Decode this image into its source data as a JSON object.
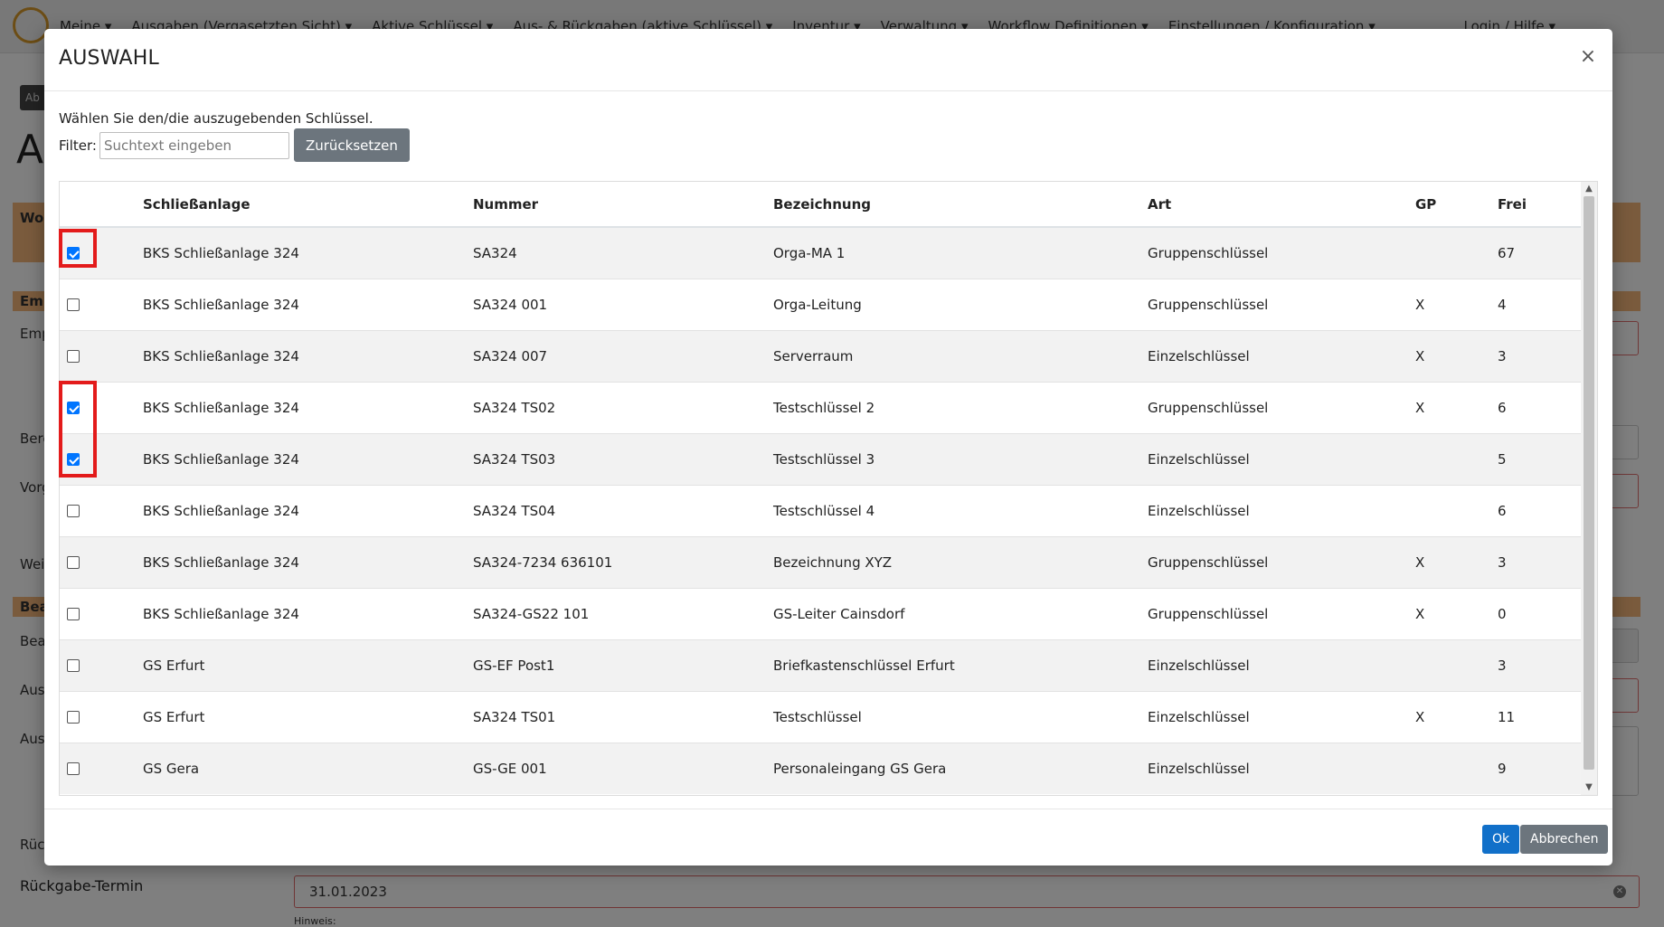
{
  "background": {
    "nav_items": [
      "Meine ▾",
      "Ausgaben (Vergasetzten Sicht) ▾",
      "Aktive Schlüssel ▾",
      "Aus- & Rückgaben (aktive Schlüssel) ▾",
      "Inventur ▾",
      "Verwaltung ▾",
      "Workflow Definitionen ▾",
      "Einstellungen / Konfiguration ▾"
    ],
    "nav_right": "Login / Hilfe ▾",
    "button_label": "Ab",
    "big_title": "Au",
    "band1_label": "Wo",
    "band2_label": "Emp",
    "band3_label": "Bea",
    "labels": [
      "Emp",
      "Bere",
      "Vorg",
      "Wei",
      "Bea",
      "Aus",
      "Aus",
      "Rüc"
    ],
    "return_label": "Rückgabe-Termin",
    "return_value": "31.01.2023",
    "hint": "Hinweis:"
  },
  "modal": {
    "title": "AUSWAHL",
    "close_symbol": "×",
    "intro": "Wählen Sie den/die auszugebenden Schlüssel.",
    "filter_label": "Filter:",
    "filter_placeholder": "Suchtext eingeben",
    "filter_value": "",
    "reset_label": "Zurücksetzen",
    "ok_label": "Ok",
    "cancel_label": "Abbrechen"
  },
  "table": {
    "columns": [
      "",
      "Schließanlage",
      "Nummer",
      "Bezeichnung",
      "Art",
      "GP",
      "Frei"
    ],
    "rows": [
      {
        "checked": true,
        "anlage": "BKS Schließanlage 324",
        "nummer": "SA324",
        "bezeichnung": "Orga-MA 1",
        "art": "Gruppenschlüssel",
        "gp": "",
        "frei": "67"
      },
      {
        "checked": false,
        "anlage": "BKS Schließanlage 324",
        "nummer": "SA324 001",
        "bezeichnung": "Orga-Leitung",
        "art": "Gruppenschlüssel",
        "gp": "X",
        "frei": "4"
      },
      {
        "checked": false,
        "anlage": "BKS Schließanlage 324",
        "nummer": "SA324 007",
        "bezeichnung": "Serverraum",
        "art": "Einzelschlüssel",
        "gp": "X",
        "frei": "3"
      },
      {
        "checked": true,
        "anlage": "BKS Schließanlage 324",
        "nummer": "SA324 TS02",
        "bezeichnung": "Testschlüssel 2",
        "art": "Gruppenschlüssel",
        "gp": "X",
        "frei": "6"
      },
      {
        "checked": true,
        "anlage": "BKS Schließanlage 324",
        "nummer": "SA324 TS03",
        "bezeichnung": "Testschlüssel 3",
        "art": "Einzelschlüssel",
        "gp": "",
        "frei": "5"
      },
      {
        "checked": false,
        "anlage": "BKS Schließanlage 324",
        "nummer": "SA324 TS04",
        "bezeichnung": "Testschlüssel 4",
        "art": "Einzelschlüssel",
        "gp": "",
        "frei": "6"
      },
      {
        "checked": false,
        "anlage": "BKS Schließanlage 324",
        "nummer": "SA324-7234 636101",
        "bezeichnung": "Bezeichnung XYZ",
        "art": "Gruppenschlüssel",
        "gp": "X",
        "frei": "3"
      },
      {
        "checked": false,
        "anlage": "BKS Schließanlage 324",
        "nummer": "SA324-GS22 101",
        "bezeichnung": "GS-Leiter Cainsdorf",
        "art": "Gruppenschlüssel",
        "gp": "X",
        "frei": "0"
      },
      {
        "checked": false,
        "anlage": "GS Erfurt",
        "nummer": "GS-EF Post1",
        "bezeichnung": "Briefkastenschlüssel Erfurt",
        "art": "Einzelschlüssel",
        "gp": "",
        "frei": "3"
      },
      {
        "checked": false,
        "anlage": "GS Erfurt",
        "nummer": "SA324 TS01",
        "bezeichnung": "Testschlüssel",
        "art": "Einzelschlüssel",
        "gp": "X",
        "frei": "11"
      },
      {
        "checked": false,
        "anlage": "GS Gera",
        "nummer": "GS-GE 001",
        "bezeichnung": "Personaleingang GS Gera",
        "art": "Einzelschlüssel",
        "gp": "",
        "frei": "9"
      }
    ]
  },
  "colors": {
    "highlight": "#e31b1b",
    "checkbox_checked": "#0075ff",
    "ok_button": "#1170c9",
    "secondary_button": "#6c757d",
    "background_band": "#f4b67a"
  }
}
